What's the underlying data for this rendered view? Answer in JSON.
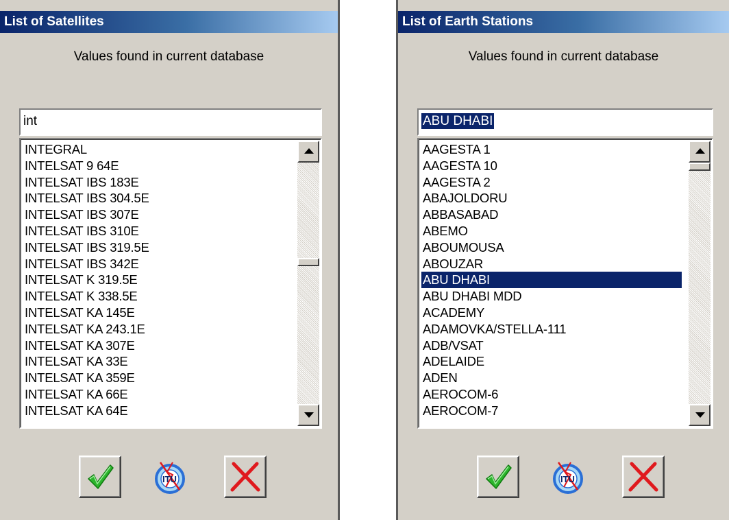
{
  "left_dialog": {
    "title": "List of Satellites",
    "subtitle": "Values found in current database",
    "search_value": "int",
    "items": [
      "INTEGRAL",
      "INTELSAT 9 64E",
      "INTELSAT IBS 183E",
      "INTELSAT IBS 304.5E",
      "INTELSAT IBS 307E",
      "INTELSAT IBS 310E",
      "INTELSAT IBS 319.5E",
      "INTELSAT IBS 342E",
      "INTELSAT K 319.5E",
      "INTELSAT K 338.5E",
      "INTELSAT KA 145E",
      "INTELSAT KA 243.1E",
      "INTELSAT KA 307E",
      "INTELSAT KA 33E",
      "INTELSAT KA 359E",
      "INTELSAT KA 66E",
      "INTELSAT KA 64E"
    ],
    "selected_item": null,
    "scroll_position": 0.41
  },
  "right_dialog": {
    "title": "List of Earth Stations",
    "subtitle": "Values found in current database",
    "search_value": "ABU DHABI",
    "items": [
      "AAGESTA 1",
      "AAGESTA 10",
      "AAGESTA 2",
      "ABAJOLDORU",
      "ABBASABAD",
      "ABEMO",
      "ABOUMOUSA",
      "ABOUZAR",
      "ABU DHABI",
      "ABU DHABI MDD",
      "ACADEMY",
      "ADAMOVKA/STELLA-111",
      "ADB/VSAT",
      "ADELAIDE",
      "ADEN",
      "AEROCOM-6",
      "AEROCOM-7"
    ],
    "selected_item": "ABU DHABI",
    "scroll_position": 0.0
  },
  "icons": {
    "ok": "checkmark-icon",
    "itu": "itu-logo-icon",
    "cancel": "red-x-icon"
  },
  "colors": {
    "title_gradient_start": "#0a246a",
    "title_gradient_end": "#a6caf0",
    "selection": "#0a246a",
    "dialog_bg": "#d4d0c8",
    "check_green": "#2db52d",
    "cancel_red": "#e0191d",
    "itu_blue": "#2a6fd6"
  }
}
